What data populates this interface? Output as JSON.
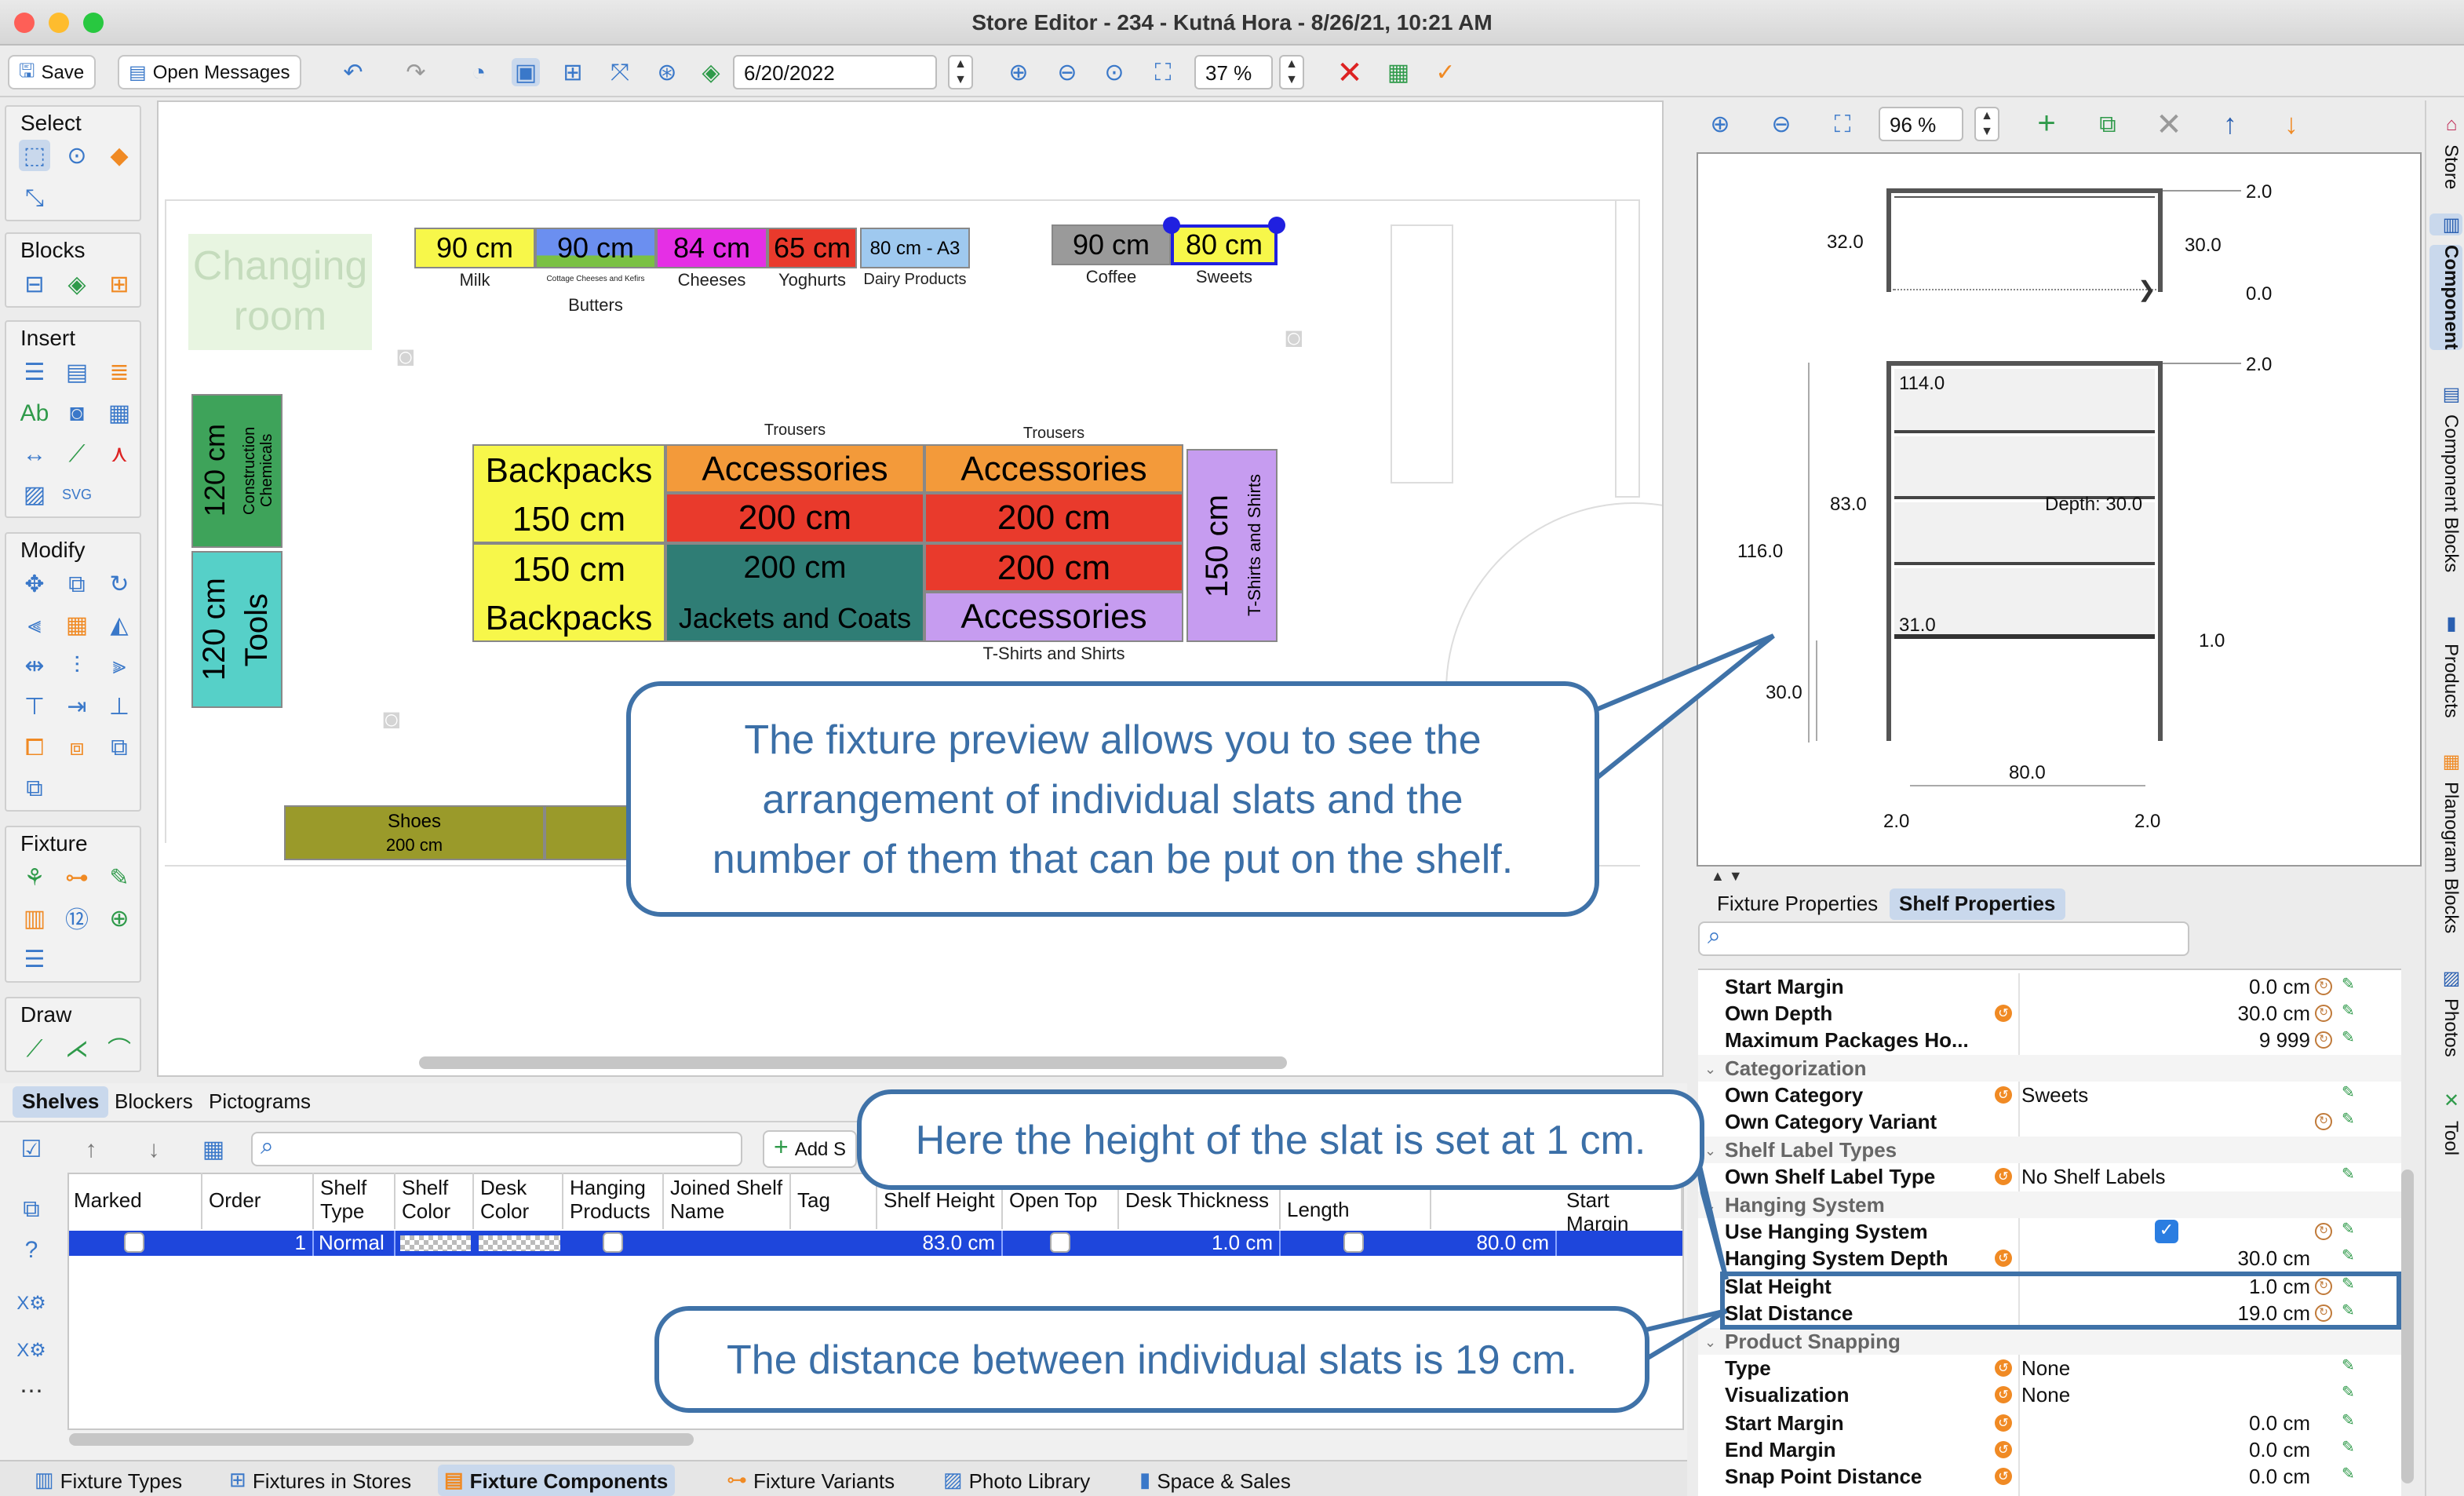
{
  "window": {
    "title": "Store Editor - 234 - Kutná Hora - 8/26/21, 10:21 AM"
  },
  "toolbar": {
    "save_label": "Save",
    "open_messages_label": "Open Messages",
    "date_value": "6/20/2022",
    "zoom_value": "37 %"
  },
  "palette": {
    "select": "Select",
    "blocks": "Blocks",
    "insert": "Insert",
    "modify": "Modify",
    "fixture": "Fixture",
    "draw": "Draw"
  },
  "canvas": {
    "changing_room": "Changing room",
    "shelves_top": [
      {
        "size": "90 cm",
        "label": "Milk"
      },
      {
        "size": "90 cm",
        "label": "Cottage Cheeses and Kefirs"
      },
      {
        "size": "84 cm",
        "label": "Cheeses"
      },
      {
        "size": "65 cm",
        "label": "Yoghurts"
      },
      {
        "size": "80 cm - A3",
        "label": "Dairy Products"
      },
      {
        "size": "90 cm",
        "label": "Coffee"
      },
      {
        "size": "80 cm",
        "label": "Sweets"
      }
    ],
    "butters_label": "Butters",
    "left_shelves": [
      {
        "size": "120 cm",
        "label": "Construction Chemicals"
      },
      {
        "size": "120 cm",
        "label": "Tools"
      }
    ],
    "backpacks": {
      "top_name": "Backpacks",
      "top_size": "150 cm",
      "bottom_size": "150 cm",
      "bottom_name": "Backpacks"
    },
    "center1": {
      "header": "Trousers",
      "name1": "Accessories",
      "size1": "200 cm",
      "size2": "200 cm",
      "name2": "Jackets and Coats"
    },
    "center2": {
      "header": "Trousers",
      "name1": "Accessories",
      "size1": "200 cm",
      "size2": "200 cm",
      "name2": "Accessories",
      "footer": "T-Shirts and Shirts"
    },
    "tshirts_vertical": {
      "size": "150 cm",
      "label": "T-Shirts and Shirts"
    },
    "shoes": {
      "label": "Shoes",
      "size": "200 cm"
    }
  },
  "callouts": {
    "preview": "The fixture preview allows you to see the arrangement of individual slats and the number of them that can be put on the shelf.",
    "height": "Here the height of the slat is set at 1 cm.",
    "distance": "The distance between individual slats is 19 cm."
  },
  "bottom": {
    "tabs": [
      "Shelves",
      "Blockers",
      "Pictograms"
    ],
    "add_label": "Add S",
    "columns": [
      "Marked",
      "Order",
      "Shelf Type",
      "Shelf Color",
      "Desk Color",
      "Hanging Products",
      "Joined Shelf Name",
      "Tag",
      "Shelf Height",
      "Open Top",
      "Desk Thickness",
      "Length",
      "Start Margin"
    ],
    "row": {
      "order": "1",
      "shelf_type": "Normal",
      "shelf_height": "83.0 cm",
      "desk_thickness": "1.0 cm",
      "start_margin": "80.0 cm"
    }
  },
  "bottom_tabs": [
    "Fixture Types",
    "Fixtures in Stores",
    "Fixture Components",
    "Fixture Variants",
    "Photo Library",
    "Space & Sales"
  ],
  "preview": {
    "zoom_value": "96 %",
    "dims": [
      "2.0",
      "32.0",
      "30.0",
      "0.0",
      "2.0",
      "114.0",
      "83.0",
      "Depth: 30.0",
      "116.0",
      "31.0",
      "1.0",
      "30.0",
      "80.0",
      "2.0",
      "2.0"
    ]
  },
  "props": {
    "tabs": [
      "Fixture Properties",
      "Shelf Properties"
    ],
    "rows": [
      {
        "key": "Start Margin",
        "value": "0.0 cm"
      },
      {
        "key": "Own Depth",
        "value": "30.0 cm"
      },
      {
        "key": "Maximum Packages Ho...",
        "value": "9 999"
      },
      {
        "key": "Categorization"
      },
      {
        "key": "Own Category",
        "value": "Sweets"
      },
      {
        "key": "Own Category Variant"
      },
      {
        "key": "Shelf Label Types"
      },
      {
        "key": "Own Shelf Label Type",
        "value": "No Shelf Labels"
      },
      {
        "key": "Hanging System"
      },
      {
        "key": "Use Hanging System"
      },
      {
        "key": "Hanging System Depth",
        "value": "30.0 cm"
      },
      {
        "key": "Slat Height",
        "value": "1.0 cm"
      },
      {
        "key": "Slat Distance",
        "value": "19.0 cm"
      },
      {
        "key": "Product Snapping"
      },
      {
        "key": "Type",
        "value": "None"
      },
      {
        "key": "Visualization",
        "value": "None"
      },
      {
        "key": "Start Margin",
        "value": "0.0 cm"
      },
      {
        "key": "End Margin",
        "value": "0.0 cm"
      },
      {
        "key": "Snap Point Distance",
        "value": "0.0 cm"
      }
    ]
  },
  "side_tabs": [
    "Store",
    "Component",
    "Component Blocks",
    "Products",
    "Planogram Blocks",
    "Photos",
    "Tool"
  ]
}
